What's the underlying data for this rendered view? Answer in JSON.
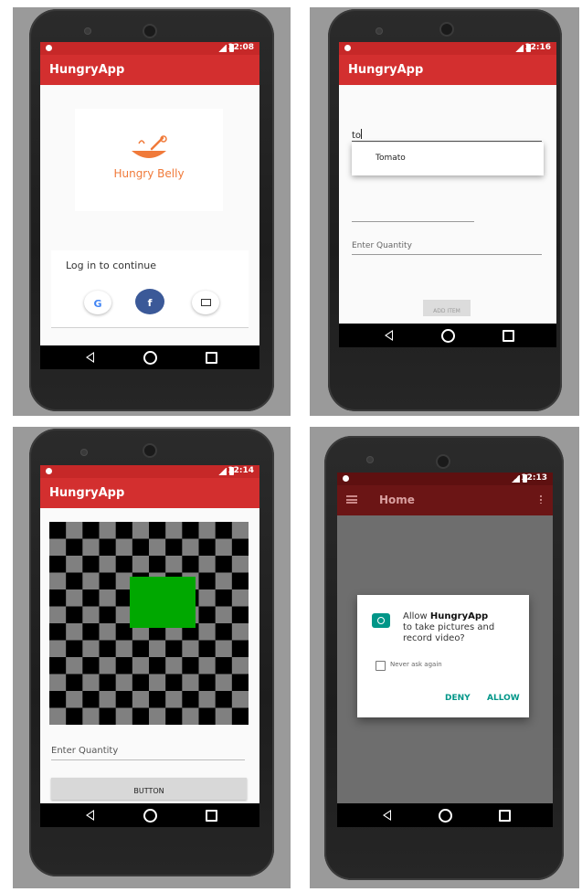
{
  "app_name": "HungryApp",
  "panels": {
    "login": {
      "time": "12:08",
      "logo_text": "Hungry Belly",
      "prompt": "Log in to continue",
      "google_glyph": "G",
      "facebook_glyph": "f",
      "icons": {
        "google": "google-icon",
        "facebook": "facebook-icon",
        "email": "email-icon"
      }
    },
    "add_item": {
      "time": "12:16",
      "search_value": "to",
      "suggestion": "Tomato",
      "quantity_placeholder": "Enter Quantity",
      "add_button": "ADD ITEM"
    },
    "camera": {
      "time": "12:14",
      "quantity_placeholder": "Enter Quantity",
      "button_label": "BUTTON",
      "checker_colors": {
        "dark": "#000000",
        "light": "#808080",
        "square": "#00a800"
      }
    },
    "permission": {
      "time": "12:13",
      "toolbar_title": "Home",
      "dialog_allow": "Allow ",
      "dialog_app": "HungryApp",
      "dialog_rest": "to take pictures and record video?",
      "never_ask": "Never ask again",
      "deny": "DENY",
      "allow": "ALLOW"
    }
  },
  "colors": {
    "accent": "#d32f2f",
    "teal": "#009688",
    "facebook": "#3b5998"
  }
}
